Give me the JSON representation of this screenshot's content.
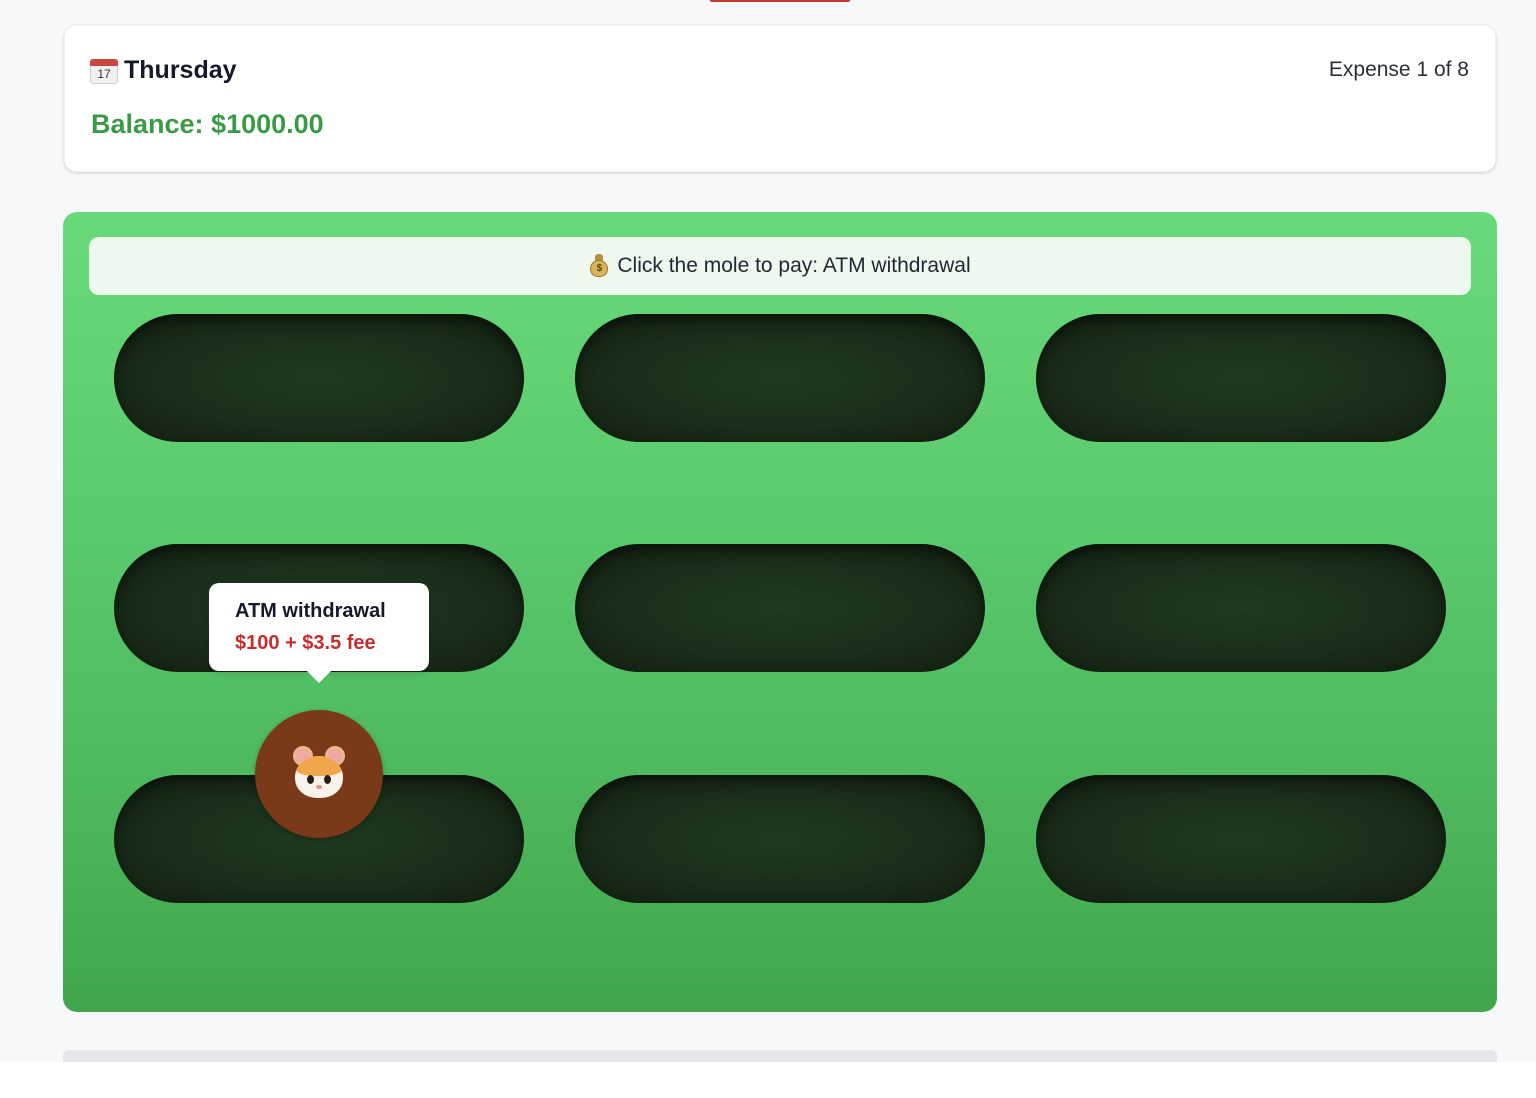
{
  "header": {
    "day_icon": "calendar-icon",
    "calendar_day_number": "17",
    "day_name": "Thursday",
    "expense_progress": "Expense 1 of 8",
    "balance": "Balance: $1000.00"
  },
  "game": {
    "prompt_icon": "money-bag-icon",
    "prompt_icon_glyph": "$",
    "prompt": "Click the mole to pay: ATM withdrawal",
    "grid": {
      "rows": 3,
      "cols": 3,
      "active_hole": 7
    },
    "mole": {
      "icon": "hamster-icon",
      "color": "#7a3a1a"
    },
    "tooltip": {
      "title": "ATM withdrawal",
      "amount": "$100 + $3.5 fee"
    }
  },
  "colors": {
    "balance": "#3a9a45",
    "fee": "#c82d2d",
    "hole": "#1a2e19",
    "field_top": "#68da7b",
    "field_bottom": "#41a64b"
  }
}
